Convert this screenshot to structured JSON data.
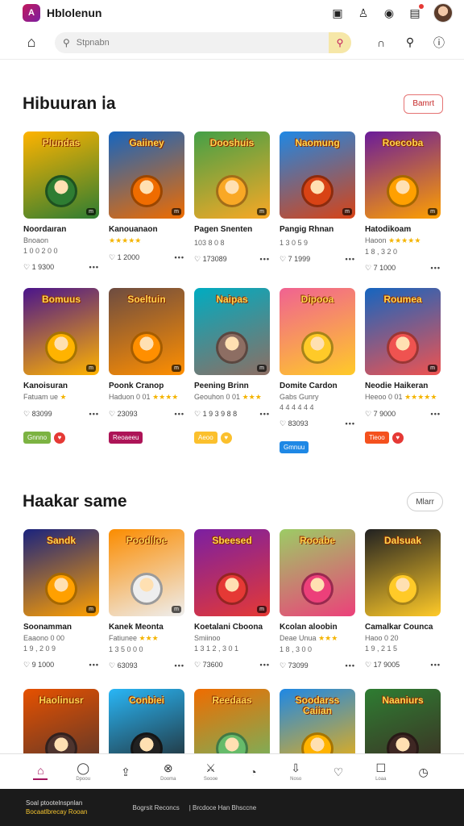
{
  "header": {
    "logo_text": "A",
    "app_title": "Hblolenun",
    "icons": [
      "cast-icon",
      "account-icon",
      "coin-icon",
      "notification-icon"
    ]
  },
  "search": {
    "placeholder": "Stpnabn"
  },
  "sections": [
    {
      "title": "Hibuuran ⅰa",
      "action": "Bamrt",
      "rows": [
        [
          {
            "title": "Noordaıran",
            "sub": "Bnoaon",
            "meta": "1 0 0 2 0 0",
            "stat": "1 9300",
            "badge": "m",
            "colors": [
              "#ffb300",
              "#2e7d32"
            ],
            "thumb_text": "Plundas"
          },
          {
            "title": "Kanouanaon",
            "sub": "",
            "stars": "★★★★★",
            "meta": "",
            "stat": "1 2000",
            "badge": "m",
            "colors": [
              "#1565c0",
              "#ef6c00"
            ],
            "thumb_text": "Gaiiney"
          },
          {
            "title": "Pagen Snenten",
            "sub": "",
            "meta": "103 8 0 8",
            "stat": "173089",
            "badge": "m",
            "colors": [
              "#43a047",
              "#f9a825"
            ],
            "thumb_text": "Dooshuis"
          },
          {
            "title": "Pangig Rhnan",
            "sub": "",
            "meta": "1 3 0 5 9",
            "stat": "7 1999",
            "badge": "m",
            "colors": [
              "#1e88e5",
              "#d84315"
            ],
            "thumb_text": "Naomung"
          },
          {
            "title": "Hatodikoam",
            "sub": "Haoon",
            "stars": "★★★★★",
            "meta": "1 8 , 3 2 0",
            "stat": "7 1000",
            "badge": "m",
            "colors": [
              "#6a1b9a",
              "#ffa000"
            ],
            "thumb_text": "Roecoba"
          }
        ],
        [
          {
            "title": "Kanoisuran",
            "sub": "Fatuam ue",
            "stars": "★",
            "meta": "",
            "stat": "83099",
            "badge": "m",
            "colors": [
              "#4a148c",
              "#ffb300"
            ],
            "thumb_text": "Bomuus"
          },
          {
            "title": "Poonk Cranop",
            "sub": "Haduon 0 01",
            "stars": "★★★★",
            "meta": "",
            "stat": "23093",
            "badge": "m",
            "colors": [
              "#6d4c41",
              "#ff8f00"
            ],
            "thumb_text": "Soeltuin"
          },
          {
            "title": "Peening Brinn",
            "sub": "Geouhon 0 01",
            "stars": "★★★",
            "meta": "",
            "stat": "1 9 3 9 8 8",
            "badge": "m",
            "colors": [
              "#00acc1",
              "#8d6e63"
            ],
            "thumb_text": "Naipas"
          },
          {
            "title": "Domite Cardon",
            "sub": "Gabs Gunry",
            "meta": "4 4 4 4 4 4",
            "stat": "83093",
            "badge": "",
            "colors": [
              "#f06292",
              "#ffca28"
            ],
            "thumb_text": "Dipooa"
          },
          {
            "title": "Neodie Haikeran",
            "sub": "Heeoo 0 01",
            "stars": "★★★★★",
            "meta": "",
            "stat": "7 9000",
            "badge": "m",
            "colors": [
              "#1565c0",
              "#ef5350"
            ],
            "thumb_text": "Roumea"
          }
        ]
      ],
      "tags": [
        {
          "label": "Gnnno",
          "color": "#7cb342",
          "heart_color": "#e53935"
        },
        {
          "label": "Reoaeeu",
          "color": "#ad1457",
          "heart_color": ""
        },
        {
          "label": "Aeoo",
          "color": "#fbc02d",
          "heart_color": "#fbc02d"
        },
        {
          "label": "Gmnuu",
          "color": "#1e88e5",
          "heart_color": ""
        },
        {
          "label": "Tieoo",
          "color": "#f4511e",
          "heart_color": "#e53935"
        }
      ]
    },
    {
      "title": "Haakar same",
      "action": "Mlarr",
      "rows": [
        [
          {
            "title": "Soonamman",
            "sub": "Eaaono 0 00",
            "meta": "1 9 , 2 0 9",
            "stat": "9 1000",
            "badge": "m",
            "colors": [
              "#1a237e",
              "#ffa000"
            ],
            "thumb_text": "Sandk"
          },
          {
            "title": "Kanek Meonta",
            "sub": "Fatiunee",
            "stars": "★★★",
            "meta": "1 3 5 0 0 0",
            "stat": "63093",
            "badge": "m",
            "colors": [
              "#fb8c00",
              "#eeeeee"
            ],
            "thumb_text": "Poodlloe"
          },
          {
            "title": "Koetalani Cboona",
            "sub": "Smiinoo",
            "meta": "1 3 1 2 , 3 0 1",
            "stat": "73600",
            "badge": "m",
            "colors": [
              "#7b1fa2",
              "#e53935"
            ],
            "thumb_text": "Sbeesed"
          },
          {
            "title": "Kcolan aloobin",
            "sub": "Deae Unua",
            "stars": "★★★",
            "meta": "1 8 , 3 0 0",
            "stat": "73099",
            "badge": "",
            "colors": [
              "#9ccc65",
              "#ec407a"
            ],
            "thumb_text": "Rooabe"
          },
          {
            "title": "Camalkar Counca",
            "sub": "Haoo 0 20",
            "meta": "1 9 , 2 1 5",
            "stat": "17 9005",
            "badge": "",
            "colors": [
              "#212121",
              "#ffca28"
            ],
            "thumb_text": "Dalsuak"
          }
        ],
        [
          {
            "title": "",
            "sub": "",
            "meta": "",
            "stat": "",
            "badge": "",
            "colors": [
              "#e65100",
              "#4e342e"
            ],
            "thumb_text": "Haolinusr"
          },
          {
            "title": "",
            "sub": "",
            "meta": "",
            "stat": "",
            "badge": "",
            "colors": [
              "#29b6f6",
              "#212121"
            ],
            "thumb_text": "Conbiei"
          },
          {
            "title": "",
            "sub": "",
            "meta": "",
            "stat": "",
            "badge": "",
            "colors": [
              "#ef6c00",
              "#66bb6a"
            ],
            "thumb_text": "Reedaas"
          },
          {
            "title": "",
            "sub": "",
            "meta": "",
            "stat": "",
            "badge": "",
            "colors": [
              "#1e88e5",
              "#ffb300"
            ],
            "thumb_text": "Soodarss Caiian"
          },
          {
            "title": "",
            "sub": "",
            "meta": "",
            "stat": "",
            "badge": "",
            "colors": [
              "#2e7d32",
              "#3e2723"
            ],
            "thumb_text": "Naaniurs"
          }
        ]
      ]
    }
  ],
  "bottom_nav": [
    {
      "icon": "⌂",
      "label": "",
      "active": true,
      "name": "home-icon"
    },
    {
      "icon": "◯",
      "label": "Dpoou",
      "active": false,
      "name": "discover-icon"
    },
    {
      "icon": "⇪",
      "label": "",
      "active": false,
      "name": "share-icon"
    },
    {
      "icon": "⊗",
      "label": "Dooma",
      "active": false,
      "name": "notification-icon"
    },
    {
      "icon": "⚔",
      "label": "Soooe",
      "active": false,
      "name": "games-icon"
    },
    {
      "icon": "◔",
      "label": "",
      "active": false,
      "name": "chat-icon"
    },
    {
      "icon": "⇩",
      "label": "Noso",
      "active": false,
      "name": "download-icon"
    },
    {
      "icon": "♡",
      "label": "",
      "active": false,
      "name": "favorites-icon"
    },
    {
      "icon": "☐",
      "label": "Loaa",
      "active": false,
      "name": "library-icon"
    },
    {
      "icon": "◷",
      "label": "",
      "active": false,
      "name": "history-icon"
    }
  ],
  "footer": {
    "line1": "Soal ptootelnspnlan",
    "line2": "Bocaatlbrecay Rooan",
    "middle": "Bogrsit Reconcs",
    "right": "| Brcdoce Han Bhsccne"
  }
}
